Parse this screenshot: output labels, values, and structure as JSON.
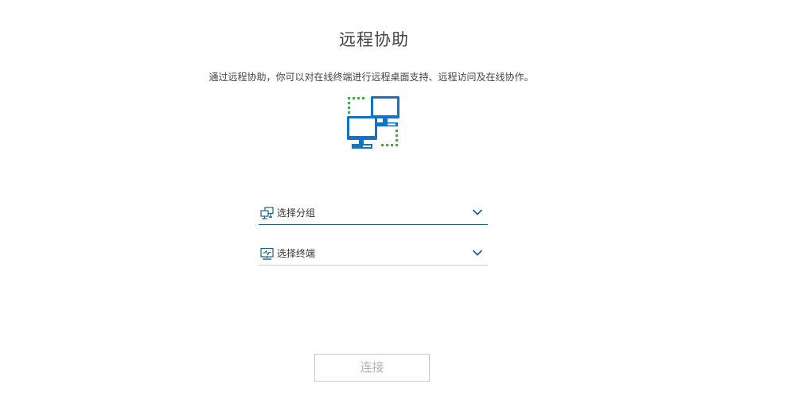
{
  "page": {
    "title": "远程协助",
    "description": "通过远程协助，你可以对在线终端进行远程桌面支持、远程访问及在线协作。"
  },
  "hero": {
    "icon": "remote-computers-icon",
    "colors": {
      "computer": "#1473c6",
      "dots": "#3cb24a"
    }
  },
  "group_select": {
    "icon": "group-network-icon",
    "label": "选择分组",
    "expand_icon": "chevron-down-icon"
  },
  "terminal_select": {
    "icon": "terminal-monitor-icon",
    "label": "选择终端",
    "expand_icon": "chevron-down-icon"
  },
  "connect_button": {
    "label": "连接",
    "state": "disabled"
  },
  "colors": {
    "accent": "#1e5d8c",
    "underline": "#c9d1d6",
    "button_border": "#c8c8c8",
    "button_text": "#b3b3b3"
  }
}
